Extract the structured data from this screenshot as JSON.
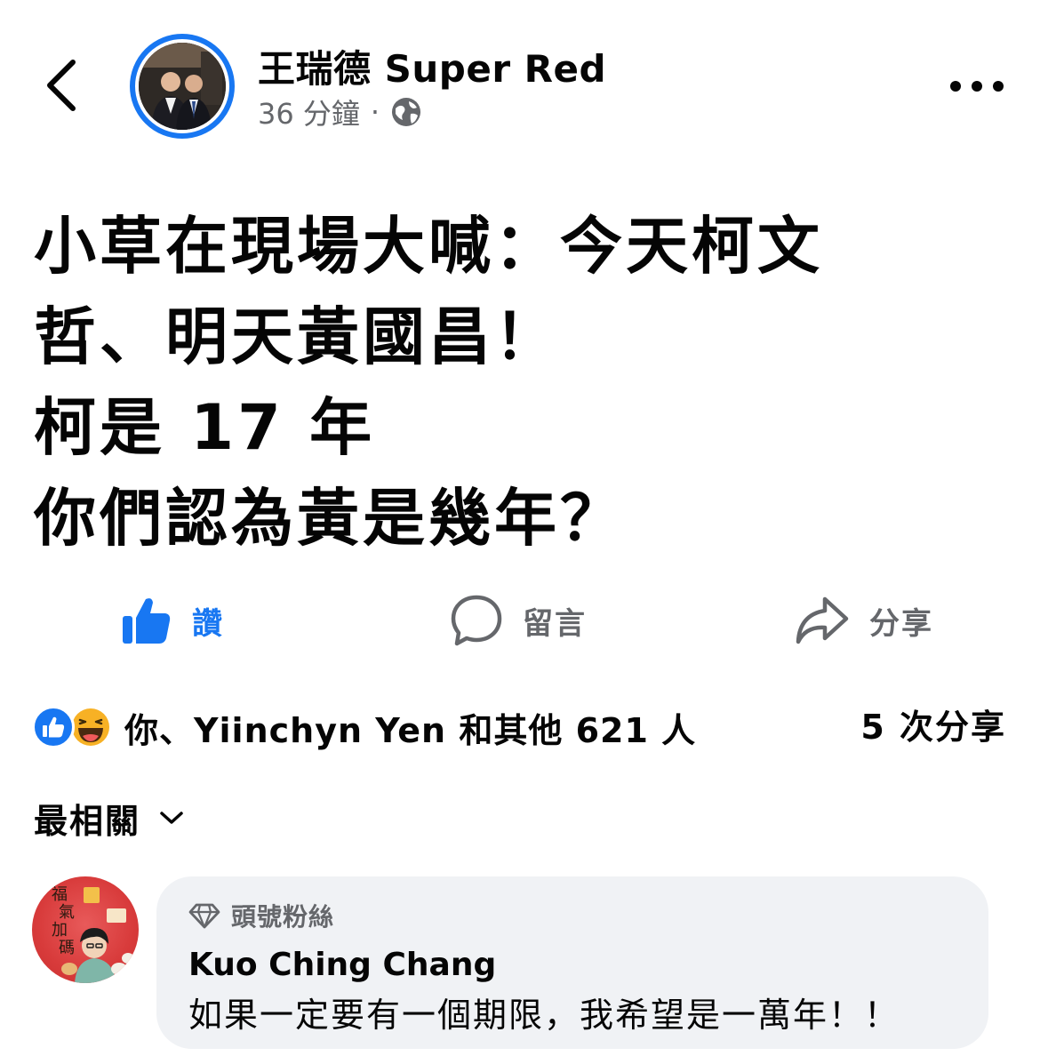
{
  "header": {
    "author_name": "王瑞德 Super Red",
    "time": "36 分鐘",
    "separator": "·",
    "privacy_icon": "globe-icon",
    "back_icon": "chevron-left-icon",
    "more_icon": "more-horizontal-icon"
  },
  "post": {
    "lines": [
      "小草在現場大喊：今天柯文",
      "哲、明天黃國昌！",
      "柯是 17 年",
      "你們認為黃是幾年？"
    ]
  },
  "actions": {
    "like_label": "讚",
    "comment_label": "留言",
    "share_label": "分享"
  },
  "reactions": {
    "summary": "你、Yiinchyn Yen 和其他 621 人",
    "shares": "5 次分享",
    "types": [
      "like",
      "haha"
    ]
  },
  "sort": {
    "label": "最相關"
  },
  "comment": {
    "badge": "頭號粉絲",
    "author": "Kuo Ching Chang",
    "text": "如果一定要有一個期限，我希望是一萬年！！",
    "avatar_text": [
      "福",
      "氣",
      "加",
      "碼"
    ]
  },
  "colors": {
    "accent": "#1877f2",
    "secondary_text": "#65676b",
    "bubble": "#f0f2f5"
  }
}
